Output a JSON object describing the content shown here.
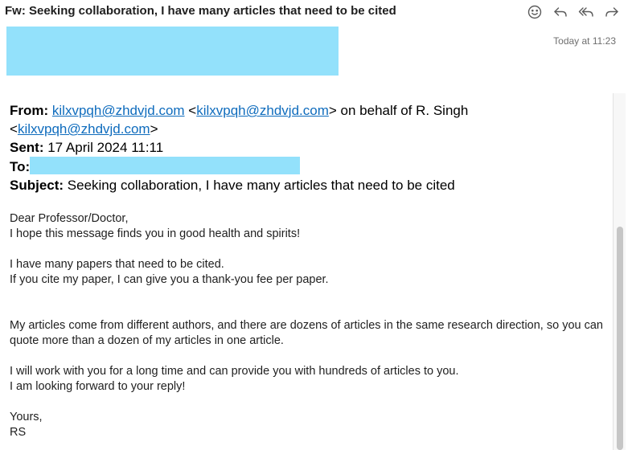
{
  "email": {
    "title": "Fw: Seeking collaboration, I have many articles that need to be cited",
    "timestamp": "Today at 11:23"
  },
  "toolbar": {
    "icons": [
      "smiley-icon",
      "reply-icon",
      "reply-all-icon",
      "forward-icon"
    ]
  },
  "forwarded": {
    "from_label": "From:",
    "from_email": "kilxvpqh@zhdvjd.com",
    "from_lt": " <",
    "from_email2": "kilxvpqh@zhdvjd.com",
    "from_suffix": "> on behalf of R. Singh",
    "from_lt2": "<",
    "from_email3": "kilxvpqh@zhdvjd.com",
    "from_gt": ">",
    "sent_label": "Sent:",
    "sent_value": " 17 April 2024 11:11",
    "to_label": "To:",
    "subject_label": "Subject:",
    "subject_value": " Seeking collaboration, I have many articles that need to be cited"
  },
  "body": {
    "p1": "Dear Professor/Doctor,",
    "p2": "I hope this message finds you in good health and spirits!",
    "p3": "I have many papers that need to be cited.",
    "p4": "If you cite my paper, I can give you a thank-you fee  per paper.",
    "p5": "My articles come from different authors, and there are dozens of articles in the same research direction, so you can quote more than a dozen of my articles in one article.",
    "p6": "I will work with you for a long time and can provide you with hundreds of articles to you.",
    "p7": "I am looking forward to your reply!",
    "p8": "Yours,",
    "p9": "RS"
  },
  "colors": {
    "redaction": "#93e1fb",
    "link": "#0f6cbd"
  }
}
